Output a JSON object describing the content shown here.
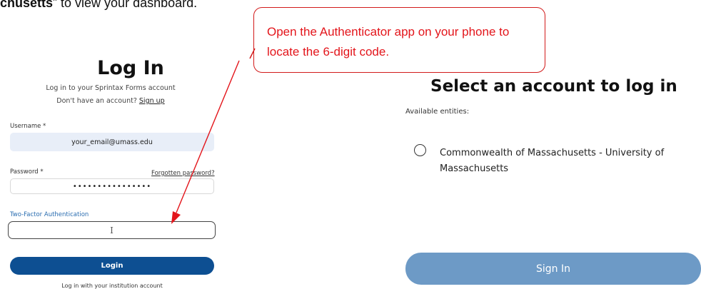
{
  "document": {
    "heading_bold": "chusetts",
    "heading_rest": "” to view your dashboard."
  },
  "login": {
    "title": "Log In",
    "subtitle": "Log in to your Sprintax Forms account",
    "no_account_text": "Don't have an account?",
    "signup_link": "Sign up",
    "username_label": "Username *",
    "username_value": "your_email@umass.edu",
    "password_label": "Password *",
    "forgot_link": "Forgotten password?",
    "password_value": "••••••••••••••••",
    "tfa_label": "Two-Factor Authentication",
    "tfa_cursor": "I",
    "login_button": "Login",
    "institution_link": "Log in with your institution account"
  },
  "callout": {
    "text": "Open the Authenticator app on your phone to locate the 6-digit code."
  },
  "account_select": {
    "title": "Select an account to log in",
    "available_label": "Available entities:",
    "entity": "Commonwealth of Massachusetts - University of Massachusetts",
    "signin_button": "Sign In"
  },
  "colors": {
    "callout_red": "#e3151b",
    "login_blue": "#0d4f92",
    "signin_blue": "#6d9ac6"
  }
}
